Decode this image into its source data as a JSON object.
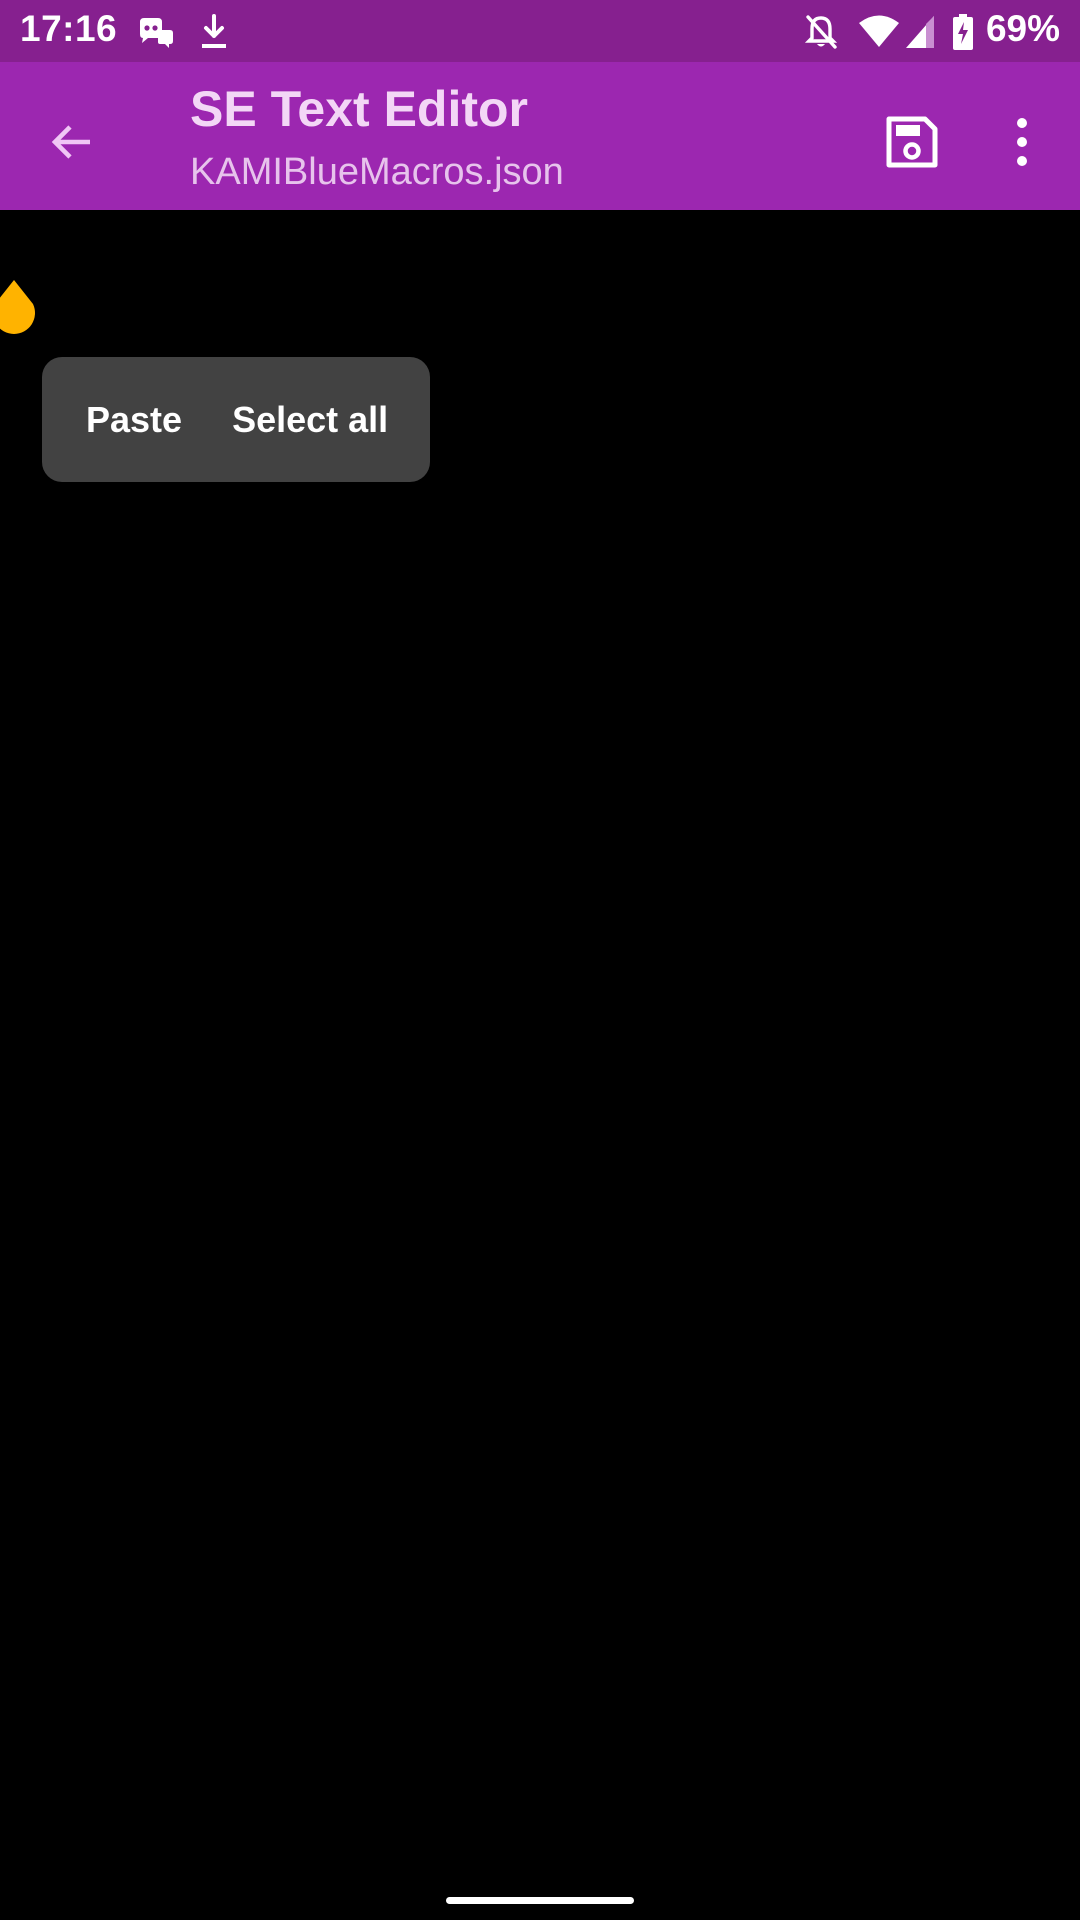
{
  "status_bar": {
    "time": "17:16",
    "battery_percent": "69%",
    "left_icons": [
      "discord-icon",
      "download-icon"
    ],
    "right_icons": [
      "bell-off-icon",
      "wifi-icon",
      "cellular-signal-icon",
      "battery-charging-icon"
    ],
    "background": "#86208F"
  },
  "app_bar": {
    "title": "SE Text Editor",
    "subtitle": "KAMIBlueMacros.json",
    "background": "#9C27B0",
    "back_icon": "arrow-back-icon",
    "save_icon": "save-icon",
    "overflow_icon": "more-vert-icon"
  },
  "editor": {
    "background": "#000000",
    "cursor_handle_color": "#FFB300"
  },
  "selection_menu": {
    "items": [
      {
        "label": "Paste"
      },
      {
        "label": "Select all"
      }
    ],
    "background": "#424242"
  }
}
